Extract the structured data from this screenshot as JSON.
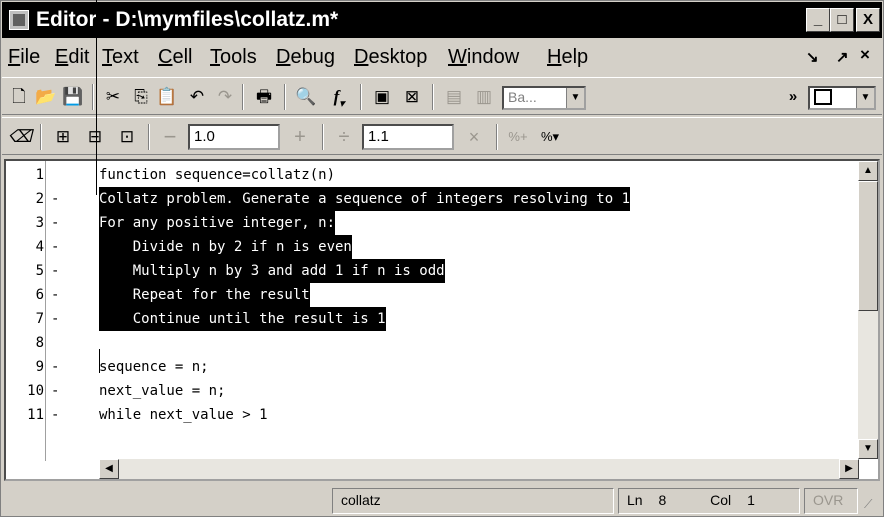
{
  "window": {
    "title": "Editor - D:\\mymfiles\\collatz.m*",
    "controls": {
      "minimize": "_",
      "maximize": "□",
      "close": "X"
    }
  },
  "menu": {
    "items": [
      "File",
      "Edit",
      "Text",
      "Cell",
      "Tools",
      "Debug",
      "Desktop",
      "Window",
      "Help"
    ],
    "right": {
      "dock": "↘",
      "undock": "↗",
      "close": "×"
    }
  },
  "toolbar1": {
    "icons": [
      "new-file-icon",
      "open-file-icon",
      "save-icon",
      "cut-icon",
      "copy-icon",
      "paste-icon",
      "undo-icon",
      "redo-icon",
      "print-icon",
      "find-icon",
      "function-icon",
      "set-breakpoint-icon",
      "clear-breakpoint-icon",
      "step-icon",
      "step-in-icon"
    ],
    "stack_combo": "Ba...",
    "more": "»"
  },
  "toolbar2": {
    "decrement_value": "1.0",
    "divide_value": "1.1"
  },
  "editor": {
    "lines": [
      {
        "num": "1",
        "dash": "",
        "text": "function sequence=collatz(n)",
        "selected": false,
        "indent": 0
      },
      {
        "num": "2",
        "dash": "-",
        "text": "Collatz problem. Generate a sequence of integers resolving to 1",
        "selected": true,
        "indent": 0
      },
      {
        "num": "3",
        "dash": "-",
        "text": "For any positive integer, n:",
        "selected": true,
        "indent": 0
      },
      {
        "num": "4",
        "dash": "-",
        "text": "    Divide n by 2 if n is even",
        "selected": true,
        "indent": 0
      },
      {
        "num": "5",
        "dash": "-",
        "text": "    Multiply n by 3 and add 1 if n is odd",
        "selected": true,
        "indent": 0
      },
      {
        "num": "6",
        "dash": "-",
        "text": "    Repeat for the result",
        "selected": true,
        "indent": 0
      },
      {
        "num": "7",
        "dash": "-",
        "text": "    Continue until the result is 1",
        "selected": true,
        "indent": 0
      },
      {
        "num": "8",
        "dash": "",
        "text": "",
        "selected": false,
        "indent": 0
      },
      {
        "num": "9",
        "dash": "-",
        "text": "sequence = n;",
        "selected": false,
        "indent": 0
      },
      {
        "num": "10",
        "dash": "-",
        "text": "next_value = n;",
        "selected": false,
        "indent": 0
      },
      {
        "num": "11",
        "dash": "-",
        "text": "while next_value > 1",
        "selected": false,
        "indent": 0
      }
    ]
  },
  "status": {
    "function_name": "collatz",
    "ln_label": "Ln",
    "ln_value": "8",
    "col_label": "Col",
    "col_value": "1",
    "mode": "OVR"
  }
}
